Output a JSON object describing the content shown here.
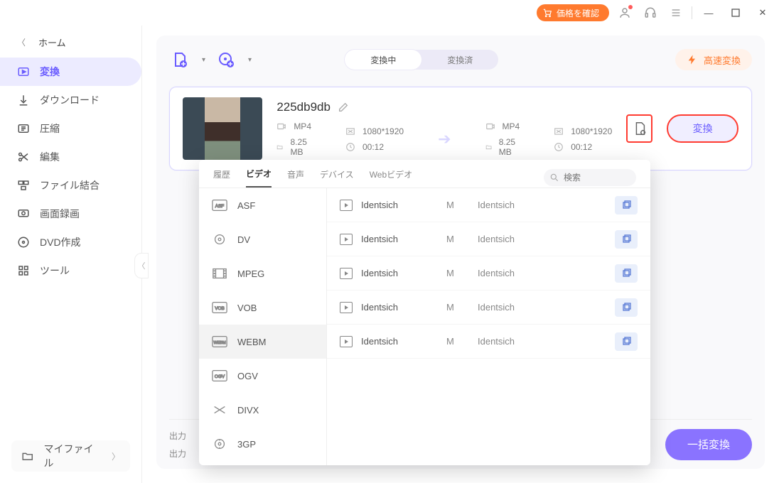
{
  "titlebar": {
    "price_label": "価格を確認"
  },
  "sidebar": {
    "home": "ホーム",
    "items": [
      {
        "label": "変換"
      },
      {
        "label": "ダウンロード"
      },
      {
        "label": "圧縮"
      },
      {
        "label": "編集"
      },
      {
        "label": "ファイル結合"
      },
      {
        "label": "画面録画"
      },
      {
        "label": "DVD作成"
      },
      {
        "label": "ツール"
      }
    ],
    "myfiles": "マイファイル"
  },
  "toolbar": {
    "tabs": [
      "変換中",
      "変換済"
    ],
    "fast": "高速変換"
  },
  "file": {
    "name": "225db9db",
    "src": {
      "fmt": "MP4",
      "res": "1080*1920",
      "size": "8.25 MB",
      "dur": "00:12"
    },
    "dst": {
      "fmt": "MP4",
      "res": "1080*1920",
      "size": "8.25 MB",
      "dur": "00:12"
    },
    "convert_label": "変換"
  },
  "bottom": {
    "out1": "出力",
    "out2": "出力",
    "batch": "一括変換"
  },
  "popup": {
    "tabs": [
      "履歴",
      "ビデオ",
      "音声",
      "デバイス",
      "Webビデオ"
    ],
    "search_placeholder": "検索",
    "formats": [
      "ASF",
      "DV",
      "MPEG",
      "VOB",
      "WEBM",
      "OGV",
      "DIVX",
      "3GP"
    ],
    "rows": [
      {
        "a": "Identsich",
        "b": "M",
        "c": "Identsich"
      },
      {
        "a": "Identsich",
        "b": "M",
        "c": "Identsich"
      },
      {
        "a": "Identsich",
        "b": "M",
        "c": "Identsich"
      },
      {
        "a": "Identsich",
        "b": "M",
        "c": "Identsich"
      },
      {
        "a": "Identsich",
        "b": "M",
        "c": "Identsich"
      }
    ]
  }
}
